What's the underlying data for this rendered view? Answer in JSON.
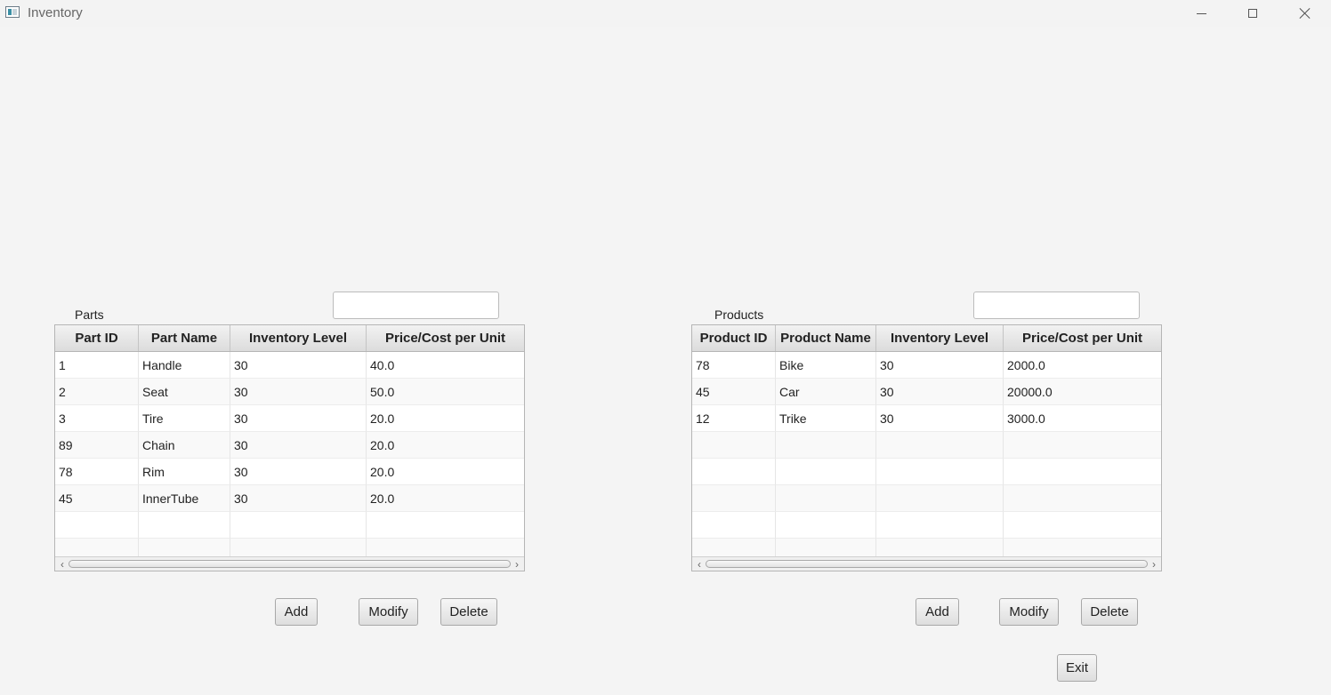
{
  "window": {
    "title": "Inventory"
  },
  "parts": {
    "label": "Parts",
    "search": {
      "value": "",
      "placeholder": ""
    },
    "columns": [
      "Part ID",
      "Part Name",
      "Inventory Level",
      "Price/Cost per Unit"
    ],
    "rows": [
      [
        "1",
        "Handle",
        "30",
        "40.0"
      ],
      [
        "2",
        "Seat",
        "30",
        "50.0"
      ],
      [
        "3",
        "Tire",
        "30",
        "20.0"
      ],
      [
        "89",
        "Chain",
        "30",
        "20.0"
      ],
      [
        "78",
        "Rim",
        "30",
        "20.0"
      ],
      [
        "45",
        "InnerTube",
        "30",
        "20.0"
      ]
    ],
    "buttons": {
      "add": "Add",
      "modify": "Modify",
      "delete": "Delete"
    }
  },
  "products": {
    "label": "Products",
    "search": {
      "value": "",
      "placeholder": ""
    },
    "columns": [
      "Product ID",
      "Product Name",
      "Inventory Level",
      "Price/Cost per Unit"
    ],
    "rows": [
      [
        "78",
        "Bike",
        "30",
        "2000.0"
      ],
      [
        "45",
        "Car",
        "30",
        "20000.0"
      ],
      [
        "12",
        "Trike",
        "30",
        "3000.0"
      ]
    ],
    "buttons": {
      "add": "Add",
      "modify": "Modify",
      "delete": "Delete"
    }
  },
  "exit_label": "Exit",
  "icons": {
    "scroll_left": "‹",
    "scroll_right": "›"
  }
}
